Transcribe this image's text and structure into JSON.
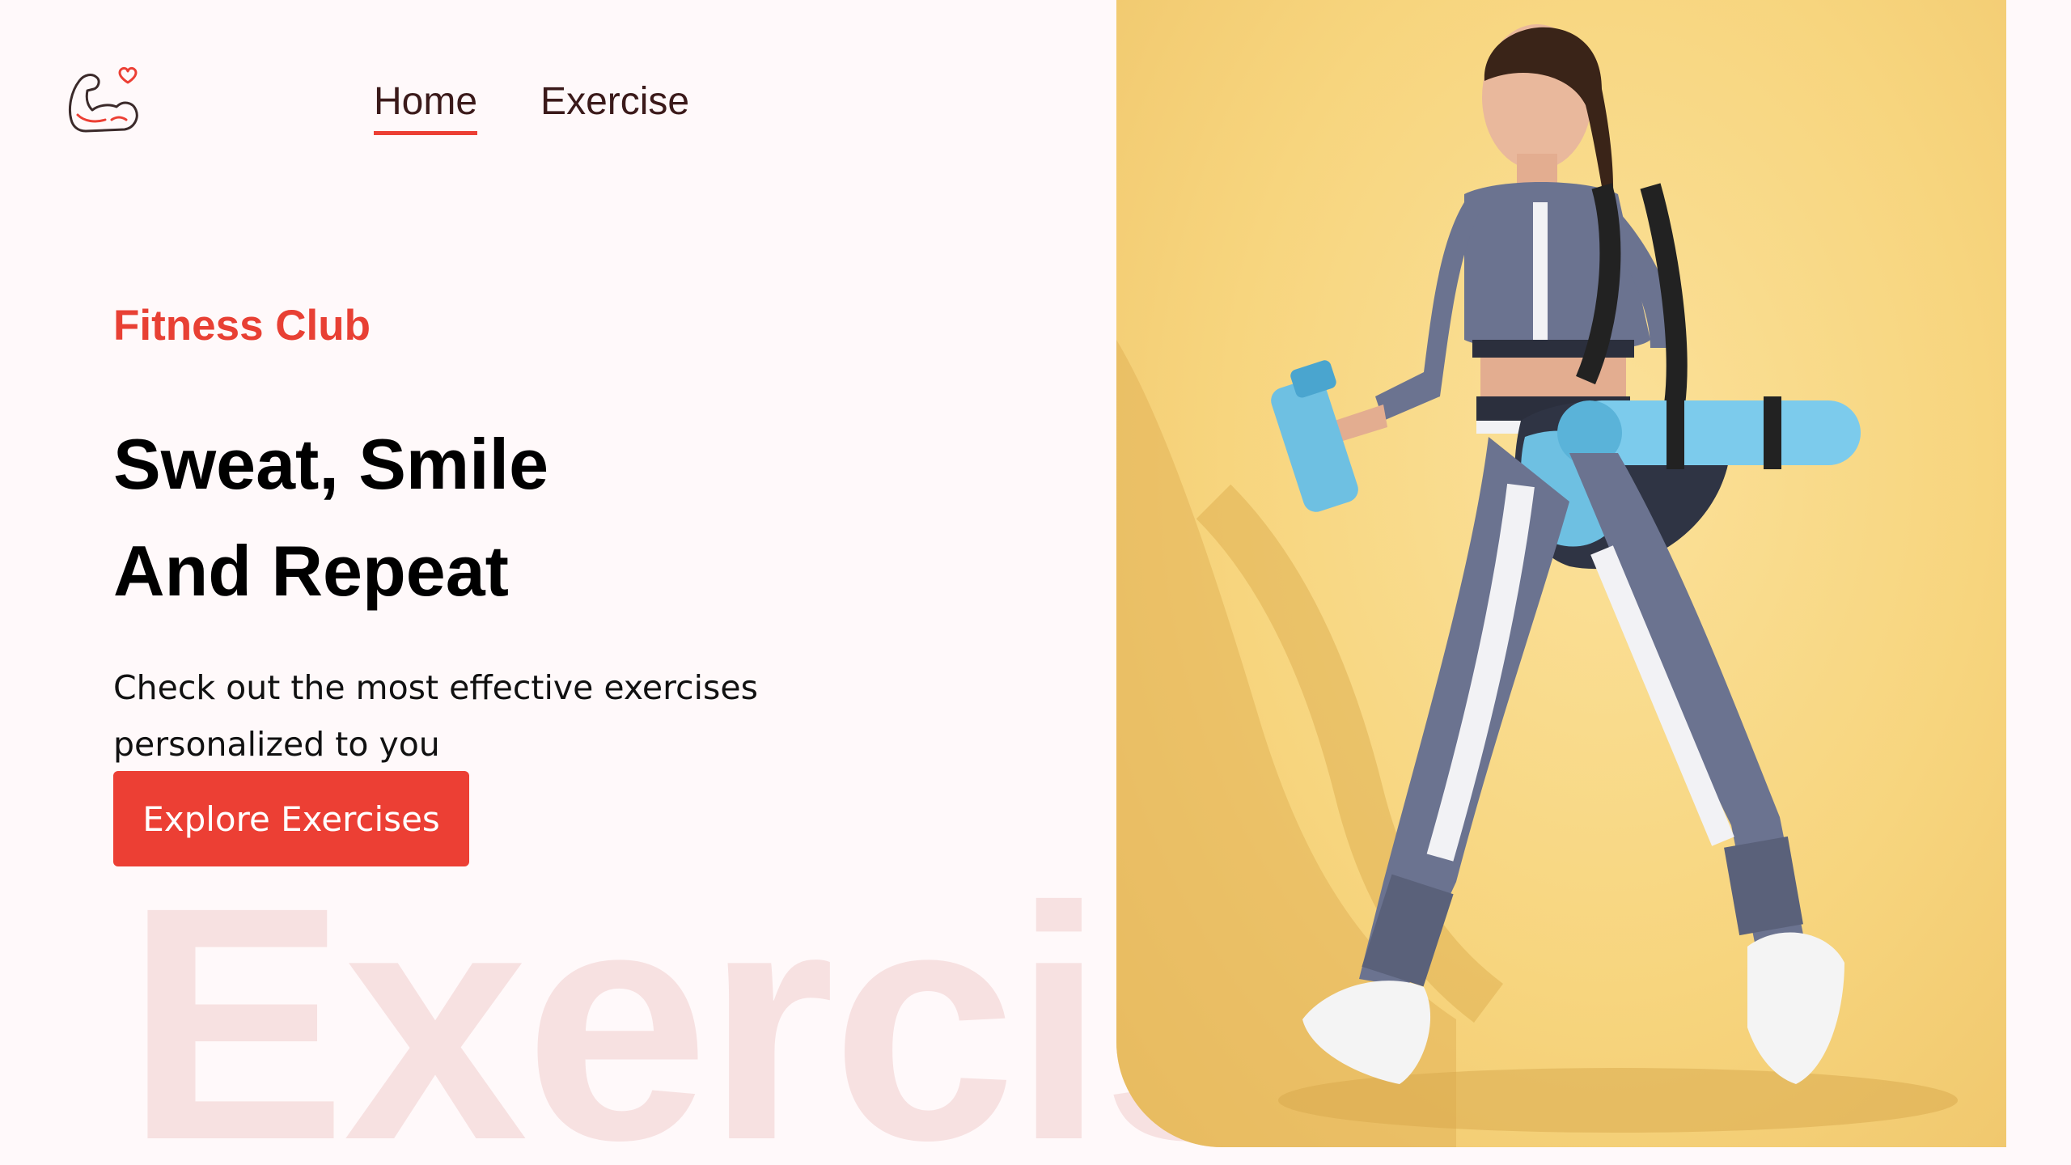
{
  "brand": {
    "logo_icon": "flexed-arm-heart-icon"
  },
  "nav": {
    "items": [
      {
        "label": "Home",
        "active": true
      },
      {
        "label": "Exercise",
        "active": false
      }
    ]
  },
  "hero": {
    "eyebrow": "Fitness Club",
    "headline_line1": "Sweat, Smile",
    "headline_line2": "And Repeat",
    "subtext": "Check out the most effective exercises personalized to you",
    "cta_label": "Explore Exercises",
    "watermark": "Exercises",
    "image_icon": "woman-walking-with-gym-bag-photo"
  },
  "colors": {
    "accent": "#ec3f34",
    "background": "#fff9fa",
    "watermark": "#f7e1e1",
    "image_background": "#f7d57e"
  }
}
